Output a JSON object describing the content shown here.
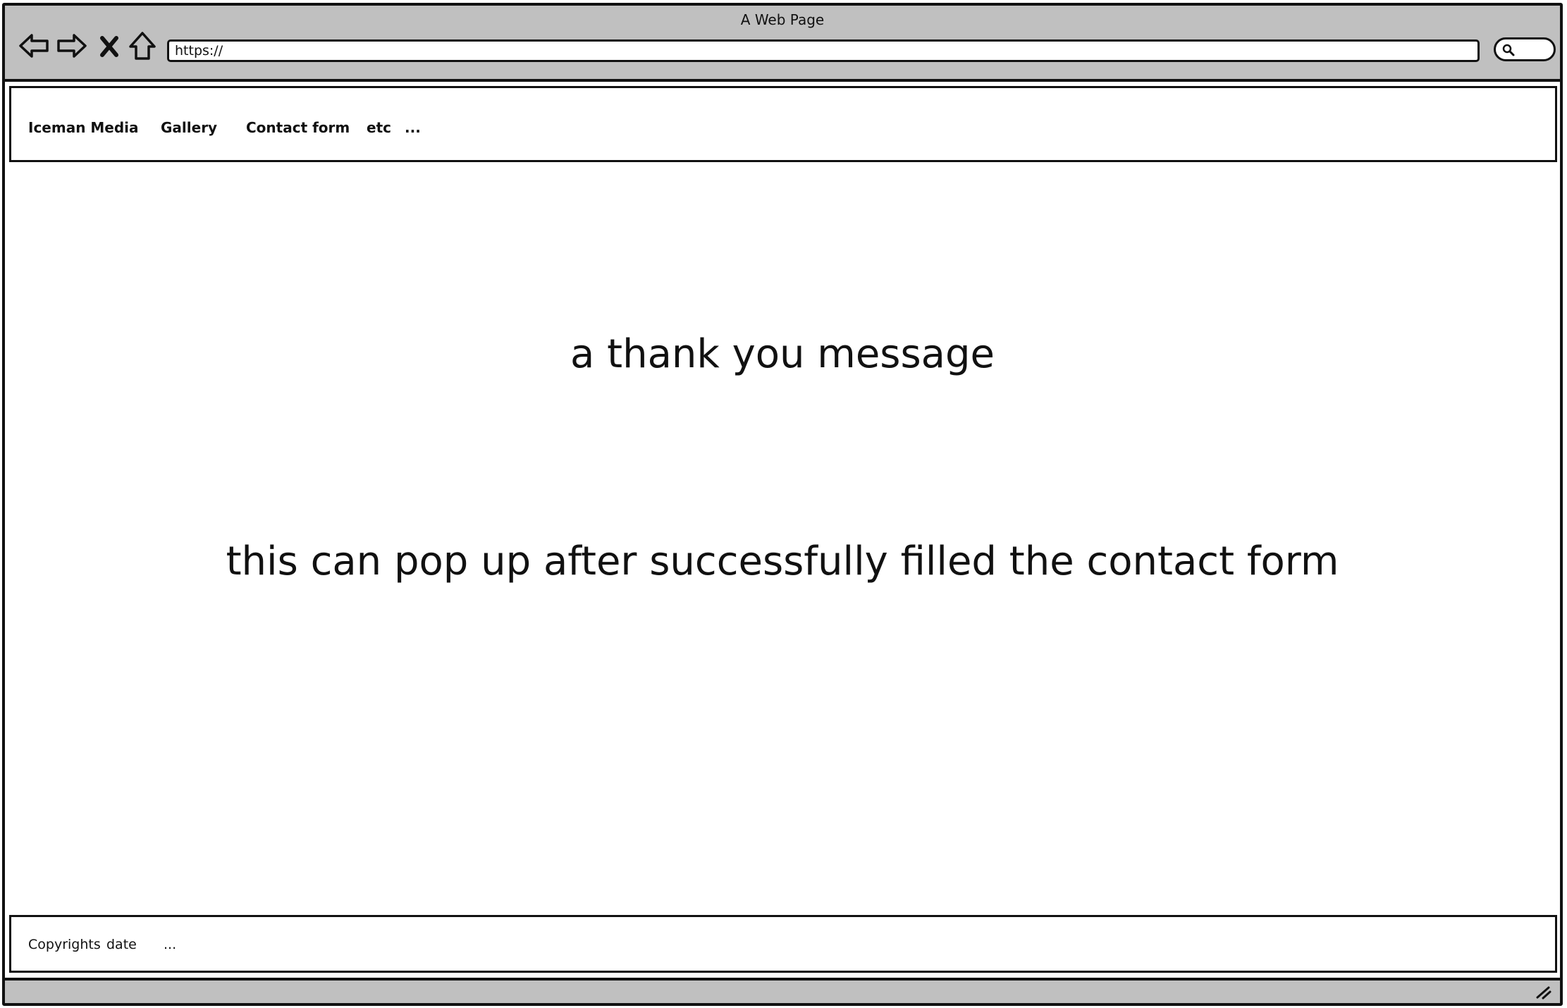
{
  "window": {
    "title": "A Web Page"
  },
  "toolbar": {
    "back_icon": "back-arrow-icon",
    "forward_icon": "forward-arrow-icon",
    "stop_icon": "close-x-icon",
    "home_icon": "home-icon",
    "url": "https://",
    "search_icon": "search-icon"
  },
  "header": {
    "nav_items": [
      {
        "label": "Iceman Media"
      },
      {
        "label": "Gallery"
      },
      {
        "label": "Contact form"
      },
      {
        "label": "etc"
      },
      {
        "label": "..."
      }
    ]
  },
  "main": {
    "heading": "a thank you message",
    "note": "this can pop up after successfully filled the contact form"
  },
  "footer": {
    "items": [
      {
        "label": "Copyrights"
      },
      {
        "label": "date"
      },
      {
        "label": "..."
      }
    ]
  },
  "colors": {
    "chrome": "#c0c0c0",
    "border": "#111111",
    "background": "#ffffff"
  }
}
